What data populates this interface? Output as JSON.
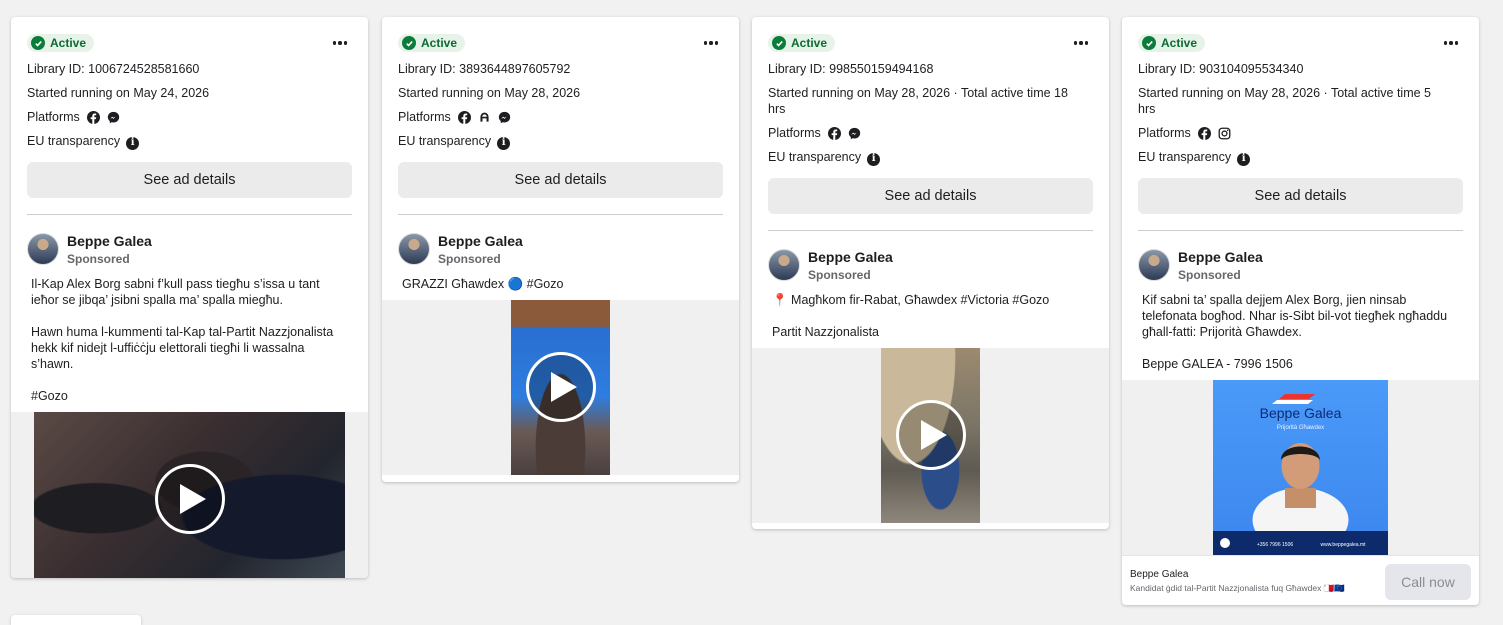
{
  "cards": [
    {
      "status": "Active",
      "library_id": "Library ID: 1006724528581660",
      "started": "Started running on May 24, 2026",
      "platforms_label": "Platforms",
      "platform_icons": [
        "facebook-icon",
        "messenger-icon"
      ],
      "eu_label": "EU transparency",
      "details_button": "See ad details",
      "advertiser": "Beppe Galea",
      "sponsored": "Sponsored",
      "body": "Il-Kap Alex Borg sabni f’kull pass tiegħu s’issa u tant ieħor se jibqa’ jsibni spalla ma’ spalla miegħu.\n\nHawn huma l-kummenti tal-Kap tal-Partit Nazzjonalista hekk kif nidejt l-uffiċċju elettorali tiegħi li wassalna s’hawn.\n\n#Gozo",
      "media": "video"
    },
    {
      "status": "Active",
      "library_id": "Library ID: 3893644897605792",
      "started": "Started running on May 28, 2026",
      "platforms_label": "Platforms",
      "platform_icons": [
        "facebook-icon",
        "audience-network-icon",
        "messenger-icon"
      ],
      "eu_label": "EU transparency",
      "details_button": "See ad details",
      "advertiser": "Beppe Galea",
      "sponsored": "Sponsored",
      "body": "GRAZZI Għawdex 🔵 #Gozo",
      "media": "video"
    },
    {
      "status": "Active",
      "library_id": "Library ID: 998550159494168",
      "started": "Started running on May 28, 2026 · Total active time 18 hrs",
      "platforms_label": "Platforms",
      "platform_icons": [
        "facebook-icon",
        "messenger-icon"
      ],
      "eu_label": "EU transparency",
      "details_button": "See ad details",
      "advertiser": "Beppe Galea",
      "sponsored": "Sponsored",
      "body": "📍 Magħkom fir-Rabat, Għawdex #Victoria #Gozo\n\nPartit Nazzjonalista",
      "media": "video"
    },
    {
      "status": "Active",
      "library_id": "Library ID: 903104095534340",
      "started": "Started running on May 28, 2026 · Total active time 5 hrs",
      "platforms_label": "Platforms",
      "platform_icons": [
        "facebook-icon",
        "instagram-icon"
      ],
      "eu_label": "EU transparency",
      "details_button": "See ad details",
      "advertiser": "Beppe Galea",
      "sponsored": "Sponsored",
      "body": "Kif sabni ta’ spalla dejjem Alex Borg, jien ninsab telefonata bogħod. Nhar is-Sibt bil-vot tiegħek ngħaddu għall-fatti: Prijorità Għawdex.\n\nBeppe GALEA - 7996 1506",
      "media": "image",
      "poster": {
        "brand": "Beppe Galea",
        "tagline": "Prijorità Għawdex",
        "phone": "+356 7996 1506",
        "site": "www.beppegalea.mt"
      },
      "cta": {
        "title": "Beppe Galea",
        "description": "Kandidat ġdid tal-Partit Nazzjonalista fuq Għawdex 🇲🇹🇪🇺",
        "button": "Call now"
      }
    }
  ],
  "colors": {
    "active_green": "#0a7d3b",
    "badge_bg": "#e7f3e8",
    "page_bg": "#f1f1f1",
    "poster_blue": "#3e8ef7"
  }
}
